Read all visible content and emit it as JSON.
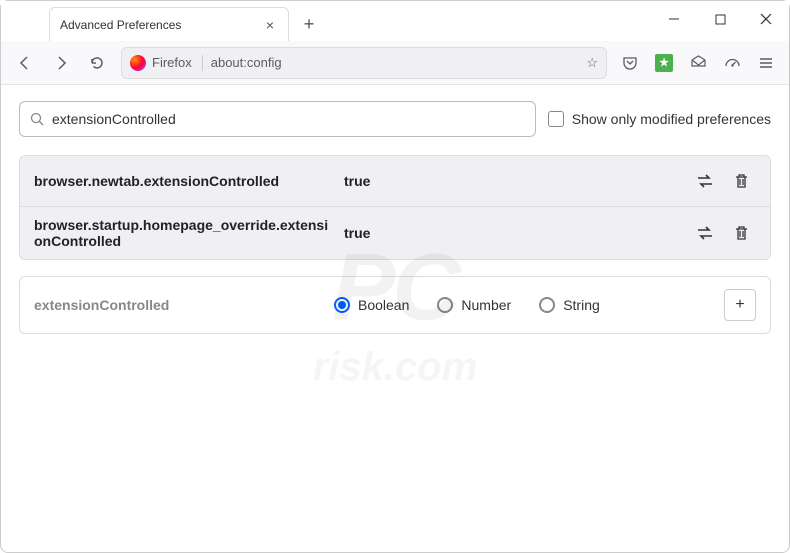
{
  "window": {
    "tab_title": "Advanced Preferences"
  },
  "toolbar": {
    "identity": "Firefox",
    "url": "about:config"
  },
  "search": {
    "value": "extensionControlled",
    "checkbox_label": "Show only modified preferences"
  },
  "results": [
    {
      "name": "browser.newtab.extensionControlled",
      "value": "true"
    },
    {
      "name": "browser.startup.homepage_override.extensionControlled",
      "value": "true"
    }
  ],
  "newpref": {
    "name": "extensionControlled",
    "options": [
      "Boolean",
      "Number",
      "String"
    ],
    "selected": "Boolean"
  }
}
